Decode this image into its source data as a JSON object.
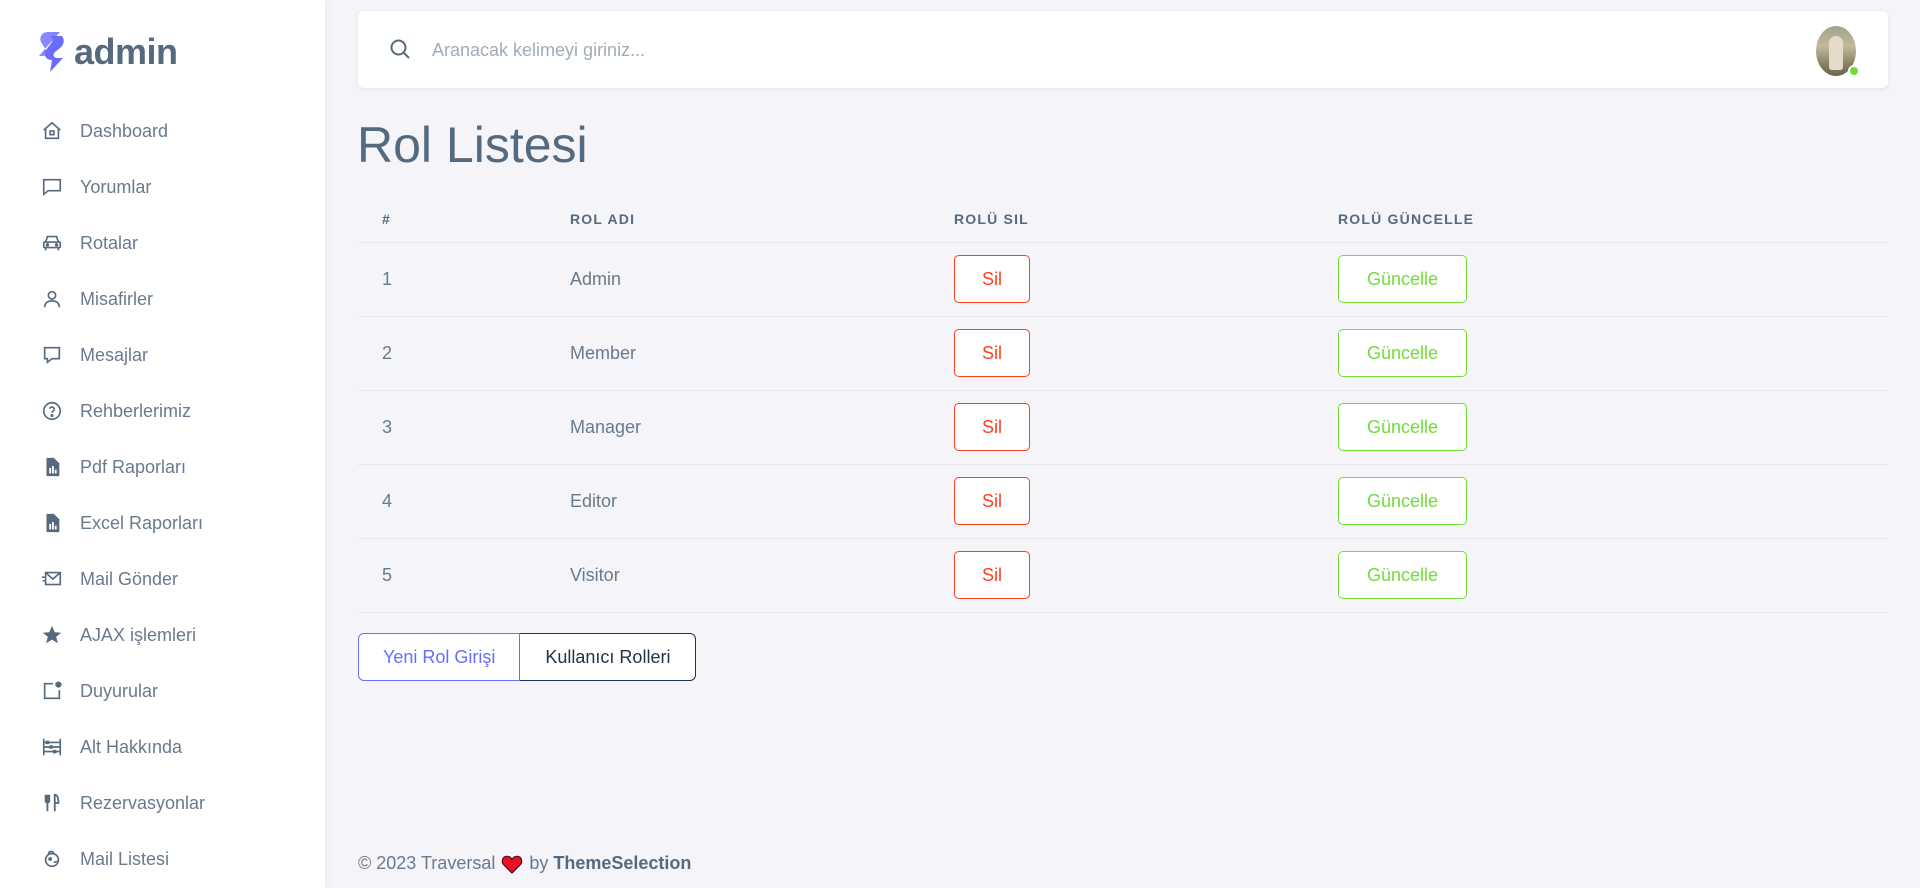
{
  "brand": {
    "name": "admin",
    "logo_icon": "brand-s-logo",
    "accent": "#696cff"
  },
  "sidebar": {
    "items": [
      {
        "label": "Dashboard",
        "icon": "home-icon"
      },
      {
        "label": "Yorumlar",
        "icon": "comment-icon"
      },
      {
        "label": "Rotalar",
        "icon": "car-icon"
      },
      {
        "label": "Misafirler",
        "icon": "user-icon"
      },
      {
        "label": "Mesajlar",
        "icon": "message-icon"
      },
      {
        "label": "Rehberlerimiz",
        "icon": "help-circle-icon"
      },
      {
        "label": "Pdf Raporları",
        "icon": "file-report-icon"
      },
      {
        "label": "Excel Raporları",
        "icon": "file-report-icon"
      },
      {
        "label": "Mail Gönder",
        "icon": "mail-send-icon"
      },
      {
        "label": "AJAX işlemleri",
        "icon": "star-icon"
      },
      {
        "label": "Duyurular",
        "icon": "notification-icon"
      },
      {
        "label": "Alt Hakkında",
        "icon": "abacus-icon"
      },
      {
        "label": "Rezervasyonlar",
        "icon": "restaurant-icon"
      },
      {
        "label": "Mail Listesi",
        "icon": "mailchimp-icon"
      }
    ]
  },
  "search": {
    "placeholder": "Aranacak kelimeyi giriniz...",
    "value": ""
  },
  "user": {
    "status_color": "#71dd37"
  },
  "page": {
    "title": "Rol Listesi"
  },
  "table": {
    "columns": [
      "#",
      "ROL ADI",
      "ROLÜ SIL",
      "ROLÜ GÜNCELLE"
    ],
    "rows": [
      {
        "id": "1",
        "name": "Admin",
        "delete_label": "Sil",
        "update_label": "Güncelle"
      },
      {
        "id": "2",
        "name": "Member",
        "delete_label": "Sil",
        "update_label": "Güncelle"
      },
      {
        "id": "3",
        "name": "Manager",
        "delete_label": "Sil",
        "update_label": "Güncelle"
      },
      {
        "id": "4",
        "name": "Editor",
        "delete_label": "Sil",
        "update_label": "Güncelle"
      },
      {
        "id": "5",
        "name": "Visitor",
        "delete_label": "Sil",
        "update_label": "Güncelle"
      }
    ]
  },
  "actions": {
    "new_role": "Yeni Rol Girişi",
    "user_roles": "Kullanıcı Rolleri"
  },
  "footer": {
    "copyright": "© 2023 Traversal",
    "by": "by",
    "link": "ThemeSelection"
  },
  "colors": {
    "danger": "#ff3e1d",
    "success": "#71dd37",
    "primary": "#696cff",
    "text": "#566a7f"
  }
}
